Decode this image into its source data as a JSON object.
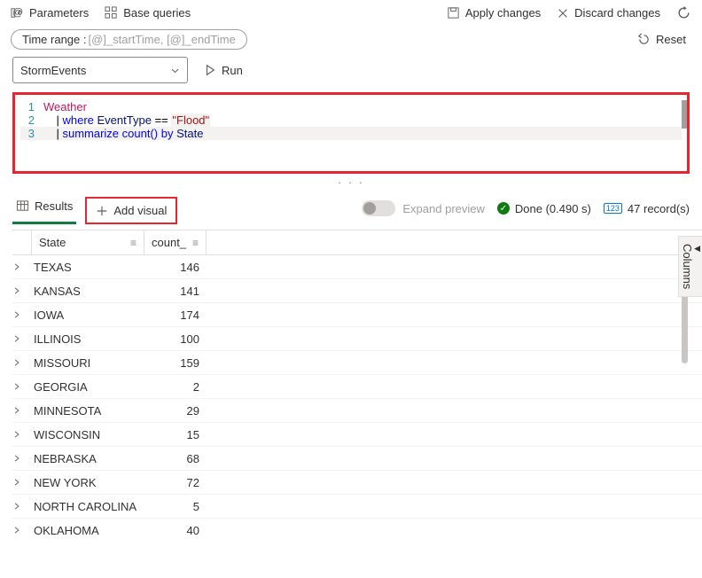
{
  "toolbar": {
    "parameters_label": "Parameters",
    "base_queries_label": "Base queries",
    "apply_label": "Apply changes",
    "discard_label": "Discard changes"
  },
  "time_range": {
    "prefix": "Time range : ",
    "value": "[@]_startTime, [@]_endTime"
  },
  "reset_label": "Reset",
  "source_select": "StormEvents",
  "run_label": "Run",
  "query": {
    "lines": [
      {
        "n": "1",
        "content": "Weather"
      },
      {
        "n": "2",
        "content": "    | where EventType == \"Flood\""
      },
      {
        "n": "3",
        "content": "    | summarize count() by State"
      }
    ]
  },
  "tabs": {
    "results": "Results",
    "add_visual": "Add visual"
  },
  "expand_preview": "Expand preview",
  "status_done": "Done (0.490 s)",
  "records": "47 record(s)",
  "columns_label": "Columns",
  "table": {
    "headers": {
      "state": "State",
      "count": "count_"
    },
    "rows": [
      {
        "state": "TEXAS",
        "count": 146
      },
      {
        "state": "KANSAS",
        "count": 141
      },
      {
        "state": "IOWA",
        "count": 174
      },
      {
        "state": "ILLINOIS",
        "count": 100
      },
      {
        "state": "MISSOURI",
        "count": 159
      },
      {
        "state": "GEORGIA",
        "count": 2
      },
      {
        "state": "MINNESOTA",
        "count": 29
      },
      {
        "state": "WISCONSIN",
        "count": 15
      },
      {
        "state": "NEBRASKA",
        "count": 68
      },
      {
        "state": "NEW YORK",
        "count": 72
      },
      {
        "state": "NORTH CAROLINA",
        "count": 5
      },
      {
        "state": "OKLAHOMA",
        "count": 40
      }
    ]
  }
}
